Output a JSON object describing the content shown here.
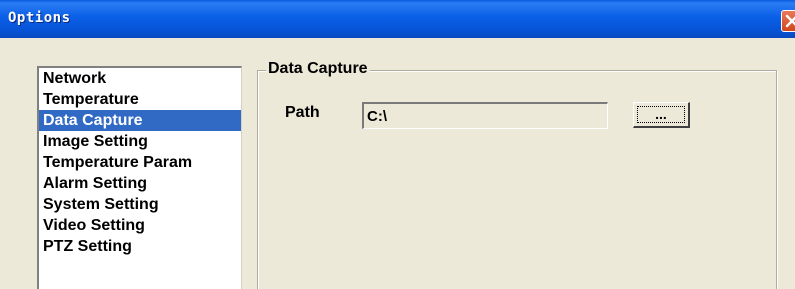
{
  "window": {
    "title": "Options",
    "close_icon": "close-icon",
    "title_bar_color": "#0a5fe6",
    "selection_color": "#316ac5"
  },
  "sidebar": {
    "items": [
      {
        "label": "Network",
        "selected": false
      },
      {
        "label": "Temperature",
        "selected": false
      },
      {
        "label": "Data Capture",
        "selected": true
      },
      {
        "label": "Image Setting",
        "selected": false
      },
      {
        "label": "Temperature Param",
        "selected": false
      },
      {
        "label": "Alarm Setting",
        "selected": false
      },
      {
        "label": "System Setting",
        "selected": false
      },
      {
        "label": "Video Setting",
        "selected": false
      },
      {
        "label": "PTZ Setting",
        "selected": false
      }
    ]
  },
  "data_capture": {
    "group_title": "Data Capture",
    "path_label": "Path",
    "path_value": "C:\\",
    "browse_label": "..."
  }
}
